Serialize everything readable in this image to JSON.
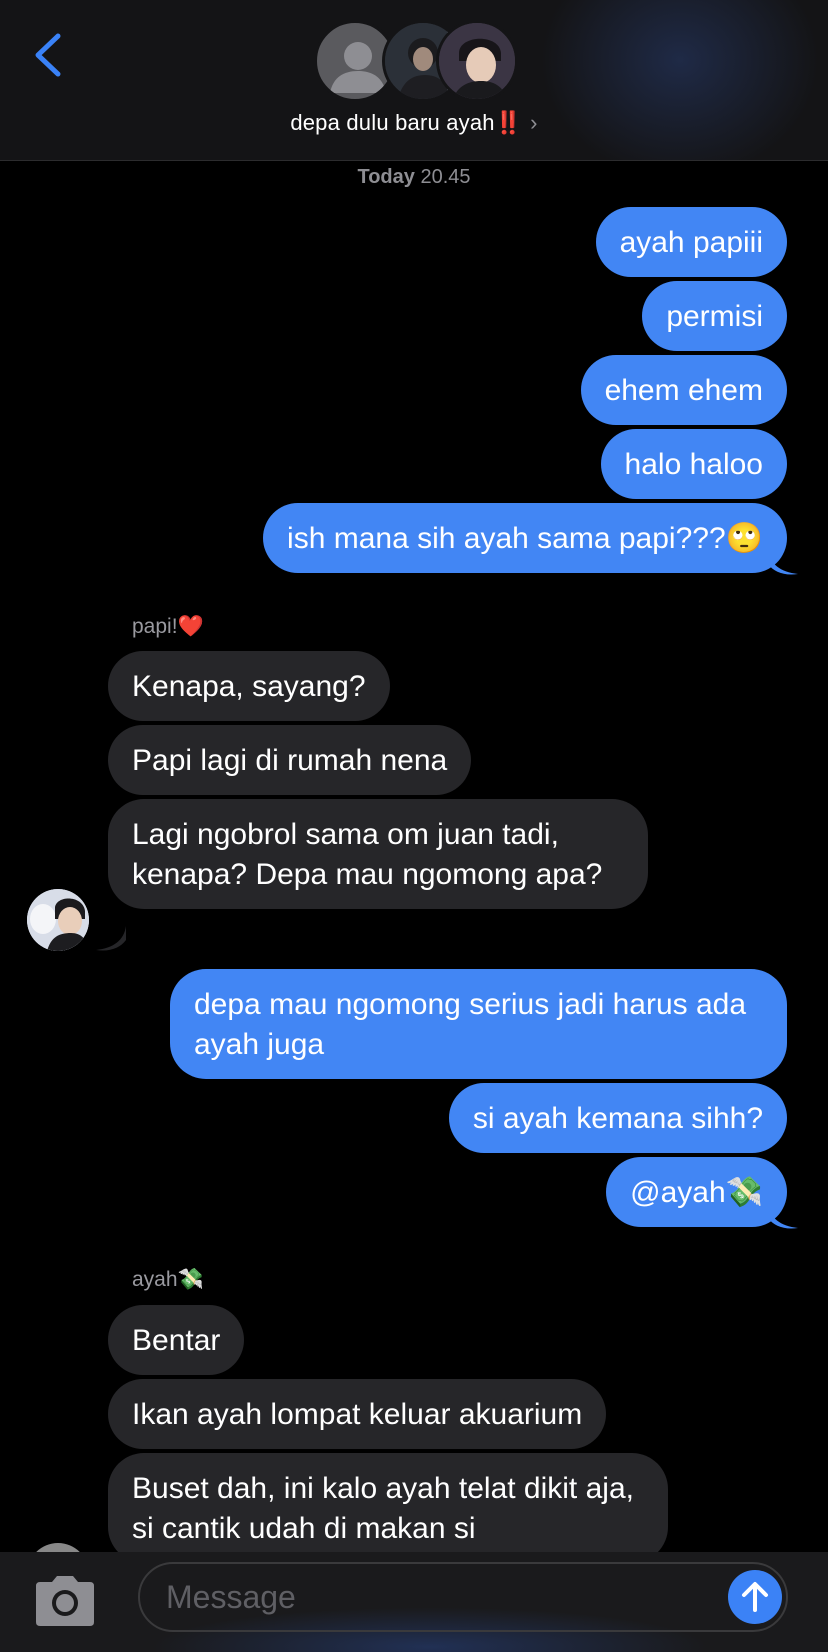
{
  "header": {
    "group_name": "depa dulu baru ayah",
    "title_emoji": "‼️",
    "chevron": "›",
    "icons": [
      "back-chevron-icon",
      "default-avatar-icon",
      "member-photo-avatar",
      "member-photo-avatar",
      "chevron-right-icon"
    ]
  },
  "timestamp": {
    "day": "Today",
    "time": "20.45"
  },
  "messages": [
    {
      "dir": "out",
      "text": "ayah papiii"
    },
    {
      "dir": "out",
      "text": "permisi"
    },
    {
      "dir": "out",
      "text": "ehem ehem"
    },
    {
      "dir": "out",
      "text": "halo haloo"
    },
    {
      "dir": "out",
      "text": "ish mana sih ayah sama papi???🙄"
    },
    {
      "dir": "in",
      "sender": "papi!❤️",
      "text": "Kenapa, sayang?"
    },
    {
      "dir": "in",
      "text": "Papi lagi di rumah nena"
    },
    {
      "dir": "in",
      "text": "Lagi ngobrol sama om juan tadi, kenapa? Depa mau ngomong apa?"
    },
    {
      "dir": "out",
      "text": "depa mau ngomong serius jadi harus ada ayah juga"
    },
    {
      "dir": "out",
      "text": "si ayah kemana sihh?"
    },
    {
      "dir": "out",
      "text": "@ayah💸"
    },
    {
      "dir": "in",
      "sender": "ayah💸",
      "text": "Bentar"
    },
    {
      "dir": "in",
      "text": "Ikan ayah lompat keluar akuarium"
    },
    {
      "dir": "in",
      "text": "Buset dah, ini kalo ayah telat dikit aja, si cantik udah di makan si"
    }
  ],
  "composer": {
    "placeholder": "Message",
    "icons": [
      "camera-icon",
      "send-arrow-icon"
    ]
  },
  "colors": {
    "outgoing_bubble": "#4286f4",
    "incoming_bubble": "#262629",
    "accent": "#3b82f6",
    "background": "#000000"
  }
}
